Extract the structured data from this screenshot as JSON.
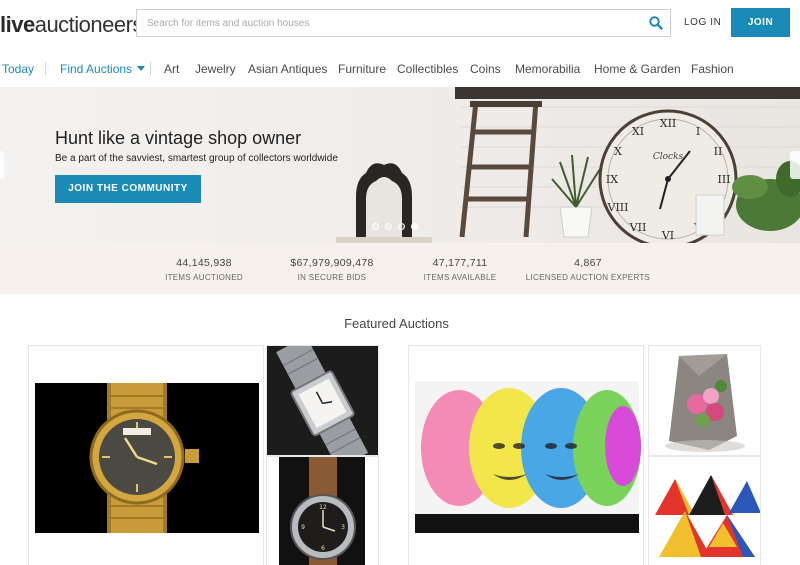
{
  "header": {
    "logo_bold": "live",
    "logo_light": "auctioneers",
    "search_placeholder": "Search for items and auction houses",
    "login_label": "LOG IN",
    "join_label": "JOIN"
  },
  "nav": {
    "today": "Today",
    "find_auctions": "Find Auctions",
    "categories": [
      "Art",
      "Jewelry",
      "Asian Antiques",
      "Furniture",
      "Collectibles",
      "Coins",
      "Memorabilia",
      "Home & Garden",
      "Fashion"
    ]
  },
  "hero": {
    "title": "Hunt like a vintage shop owner",
    "subtitle": "Be a part of the savviest, smartest group of collectors worldwide",
    "cta": "JOIN THE COMMUNITY",
    "clock_text": "Clocks"
  },
  "stats": [
    {
      "value": "44,145,938",
      "label": "ITEMS AUCTIONED"
    },
    {
      "value": "$67,979,909,478",
      "label": "IN SECURE BIDS"
    },
    {
      "value": "47,177,711",
      "label": "ITEMS AVAILABLE"
    },
    {
      "value": "4,867",
      "label": "LICENSED AUCTION EXPERTS"
    }
  ],
  "featured": {
    "title": "Featured Auctions"
  },
  "colors": {
    "accent": "#1a8ab7",
    "stats_bg": "#f6f1ec"
  }
}
